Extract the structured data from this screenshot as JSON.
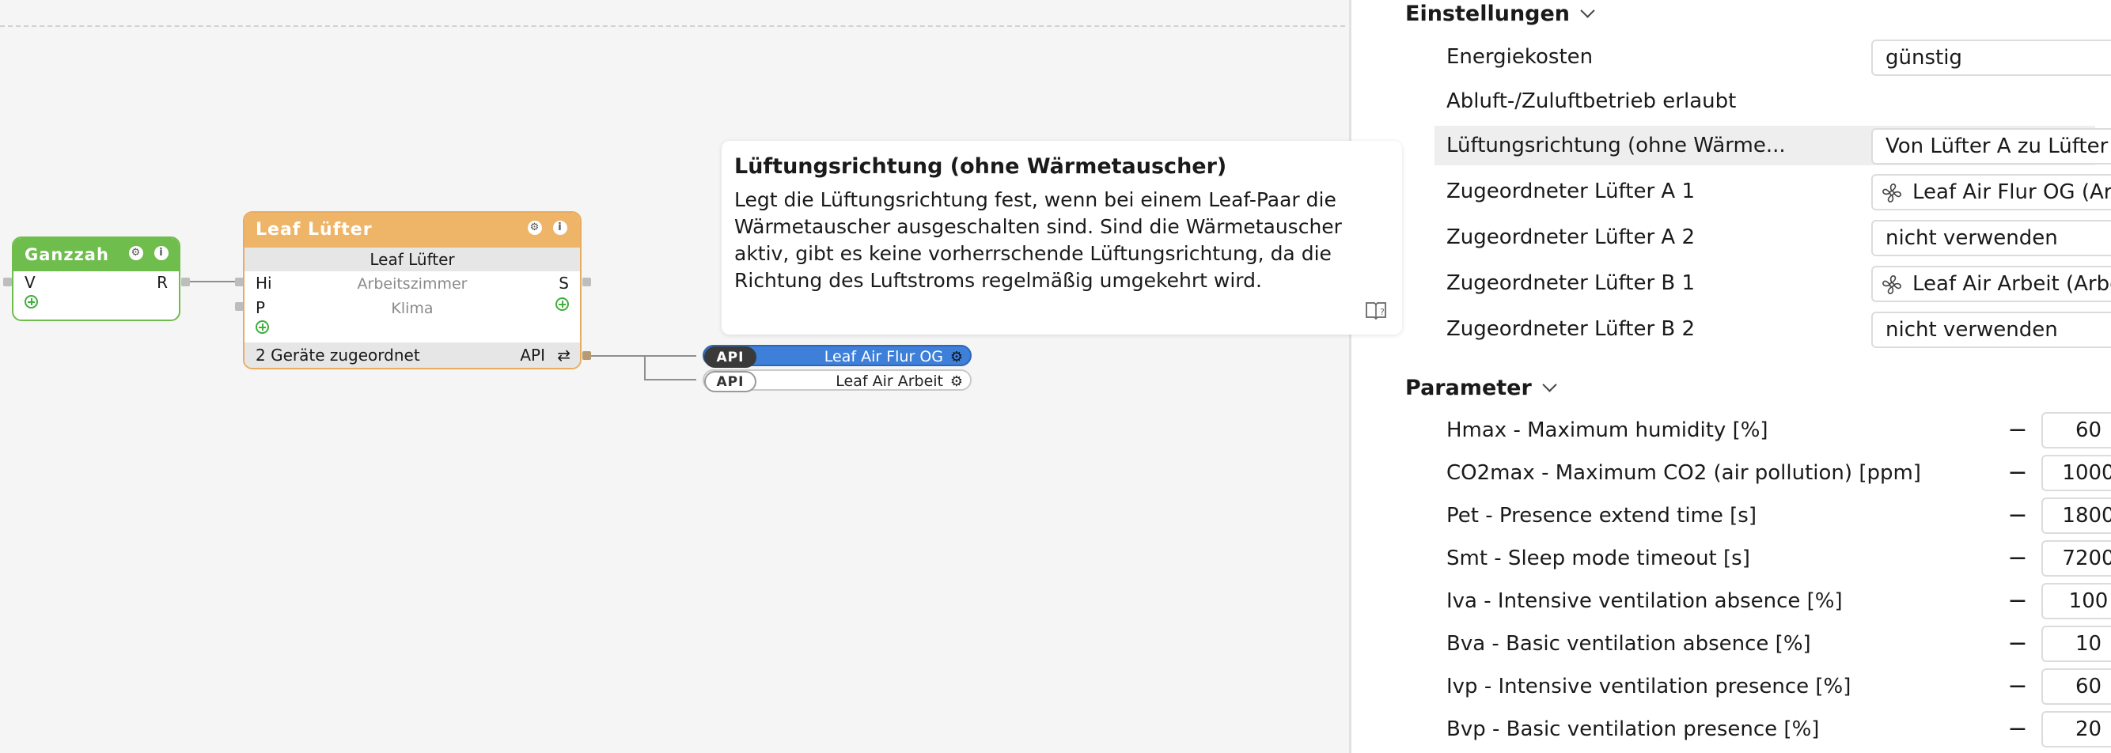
{
  "canvas": {
    "ganzzah_block": {
      "title": "Ganzzah",
      "input_label": "V",
      "output_label": "R",
      "header_color": "#6fbd4c"
    },
    "leaf_block": {
      "title": "Leaf Lüfter",
      "subtitle": "Leaf Lüfter",
      "inputs": [
        {
          "label": "Hi",
          "value": "Arbeitszimmer"
        },
        {
          "label": "P",
          "value": "Klima"
        }
      ],
      "output_label": "S",
      "footer_text": "2 Geräte zugeordnet",
      "footer_api": "API",
      "header_color": "#eeb569"
    },
    "devices": [
      {
        "badge": "API",
        "name": "Leaf Air Flur OG",
        "selected": true
      },
      {
        "badge": "API",
        "name": "Leaf Air Arbeit",
        "selected": false
      }
    ]
  },
  "tooltip": {
    "title": "Lüftungsrichtung (ohne Wärmetauscher)",
    "body": "Legt die Lüftungsrichtung fest, wenn bei einem Leaf-Paar die Wärmetauscher ausgeschalten sind. Sind die Wärmetauscher aktiv, gibt es keine vorherrschende Lüftungsrichtung, da die Richtung des Luftstroms regelmäßig umgekehrt wird."
  },
  "settings": {
    "title": "Einstellungen",
    "rows": [
      {
        "label": "Energiekosten",
        "value": "günstig"
      },
      {
        "label": "Abluft-/Zuluftbetrieb erlaubt",
        "checked": true
      },
      {
        "label": "Lüftungsrichtung (ohne Wärme...",
        "value": "Von Lüfter A zu Lüfter B"
      },
      {
        "label": "Zugeordneter Lüfter A 1",
        "value": "Leaf Air Flur OG (Arbeit"
      },
      {
        "label": "Zugeordneter Lüfter A 2",
        "value": "nicht verwenden"
      },
      {
        "label": "Zugeordneter Lüfter B 1",
        "value": "Leaf Air Arbeit (Arbeitsz"
      },
      {
        "label": "Zugeordneter Lüfter B 2",
        "value": "nicht verwenden"
      }
    ]
  },
  "parameters": {
    "title": "Parameter",
    "rows": [
      {
        "label": "Hmax - Maximum humidity [%]",
        "value": "60"
      },
      {
        "label": "CO2max - Maximum CO2 (air pollution) [ppm]",
        "value": "1000"
      },
      {
        "label": "Pet - Presence extend time [s]",
        "value": "1800"
      },
      {
        "label": "Smt - Sleep mode timeout [s]",
        "value": "7200"
      },
      {
        "label": "Iva - Intensive ventilation absence [%]",
        "value": "100"
      },
      {
        "label": "Bva - Basic ventilation absence [%]",
        "value": "10"
      },
      {
        "label": "Ivp - Intensive ventilation presence [%]",
        "value": "60"
      },
      {
        "label": "Bvp - Basic ventilation presence [%]",
        "value": "20"
      }
    ],
    "minus_symbol": "−",
    "plus_symbol": "+"
  },
  "colors": {
    "accent_blue": "#3d7fd9",
    "check_green": "#6fc24a"
  }
}
